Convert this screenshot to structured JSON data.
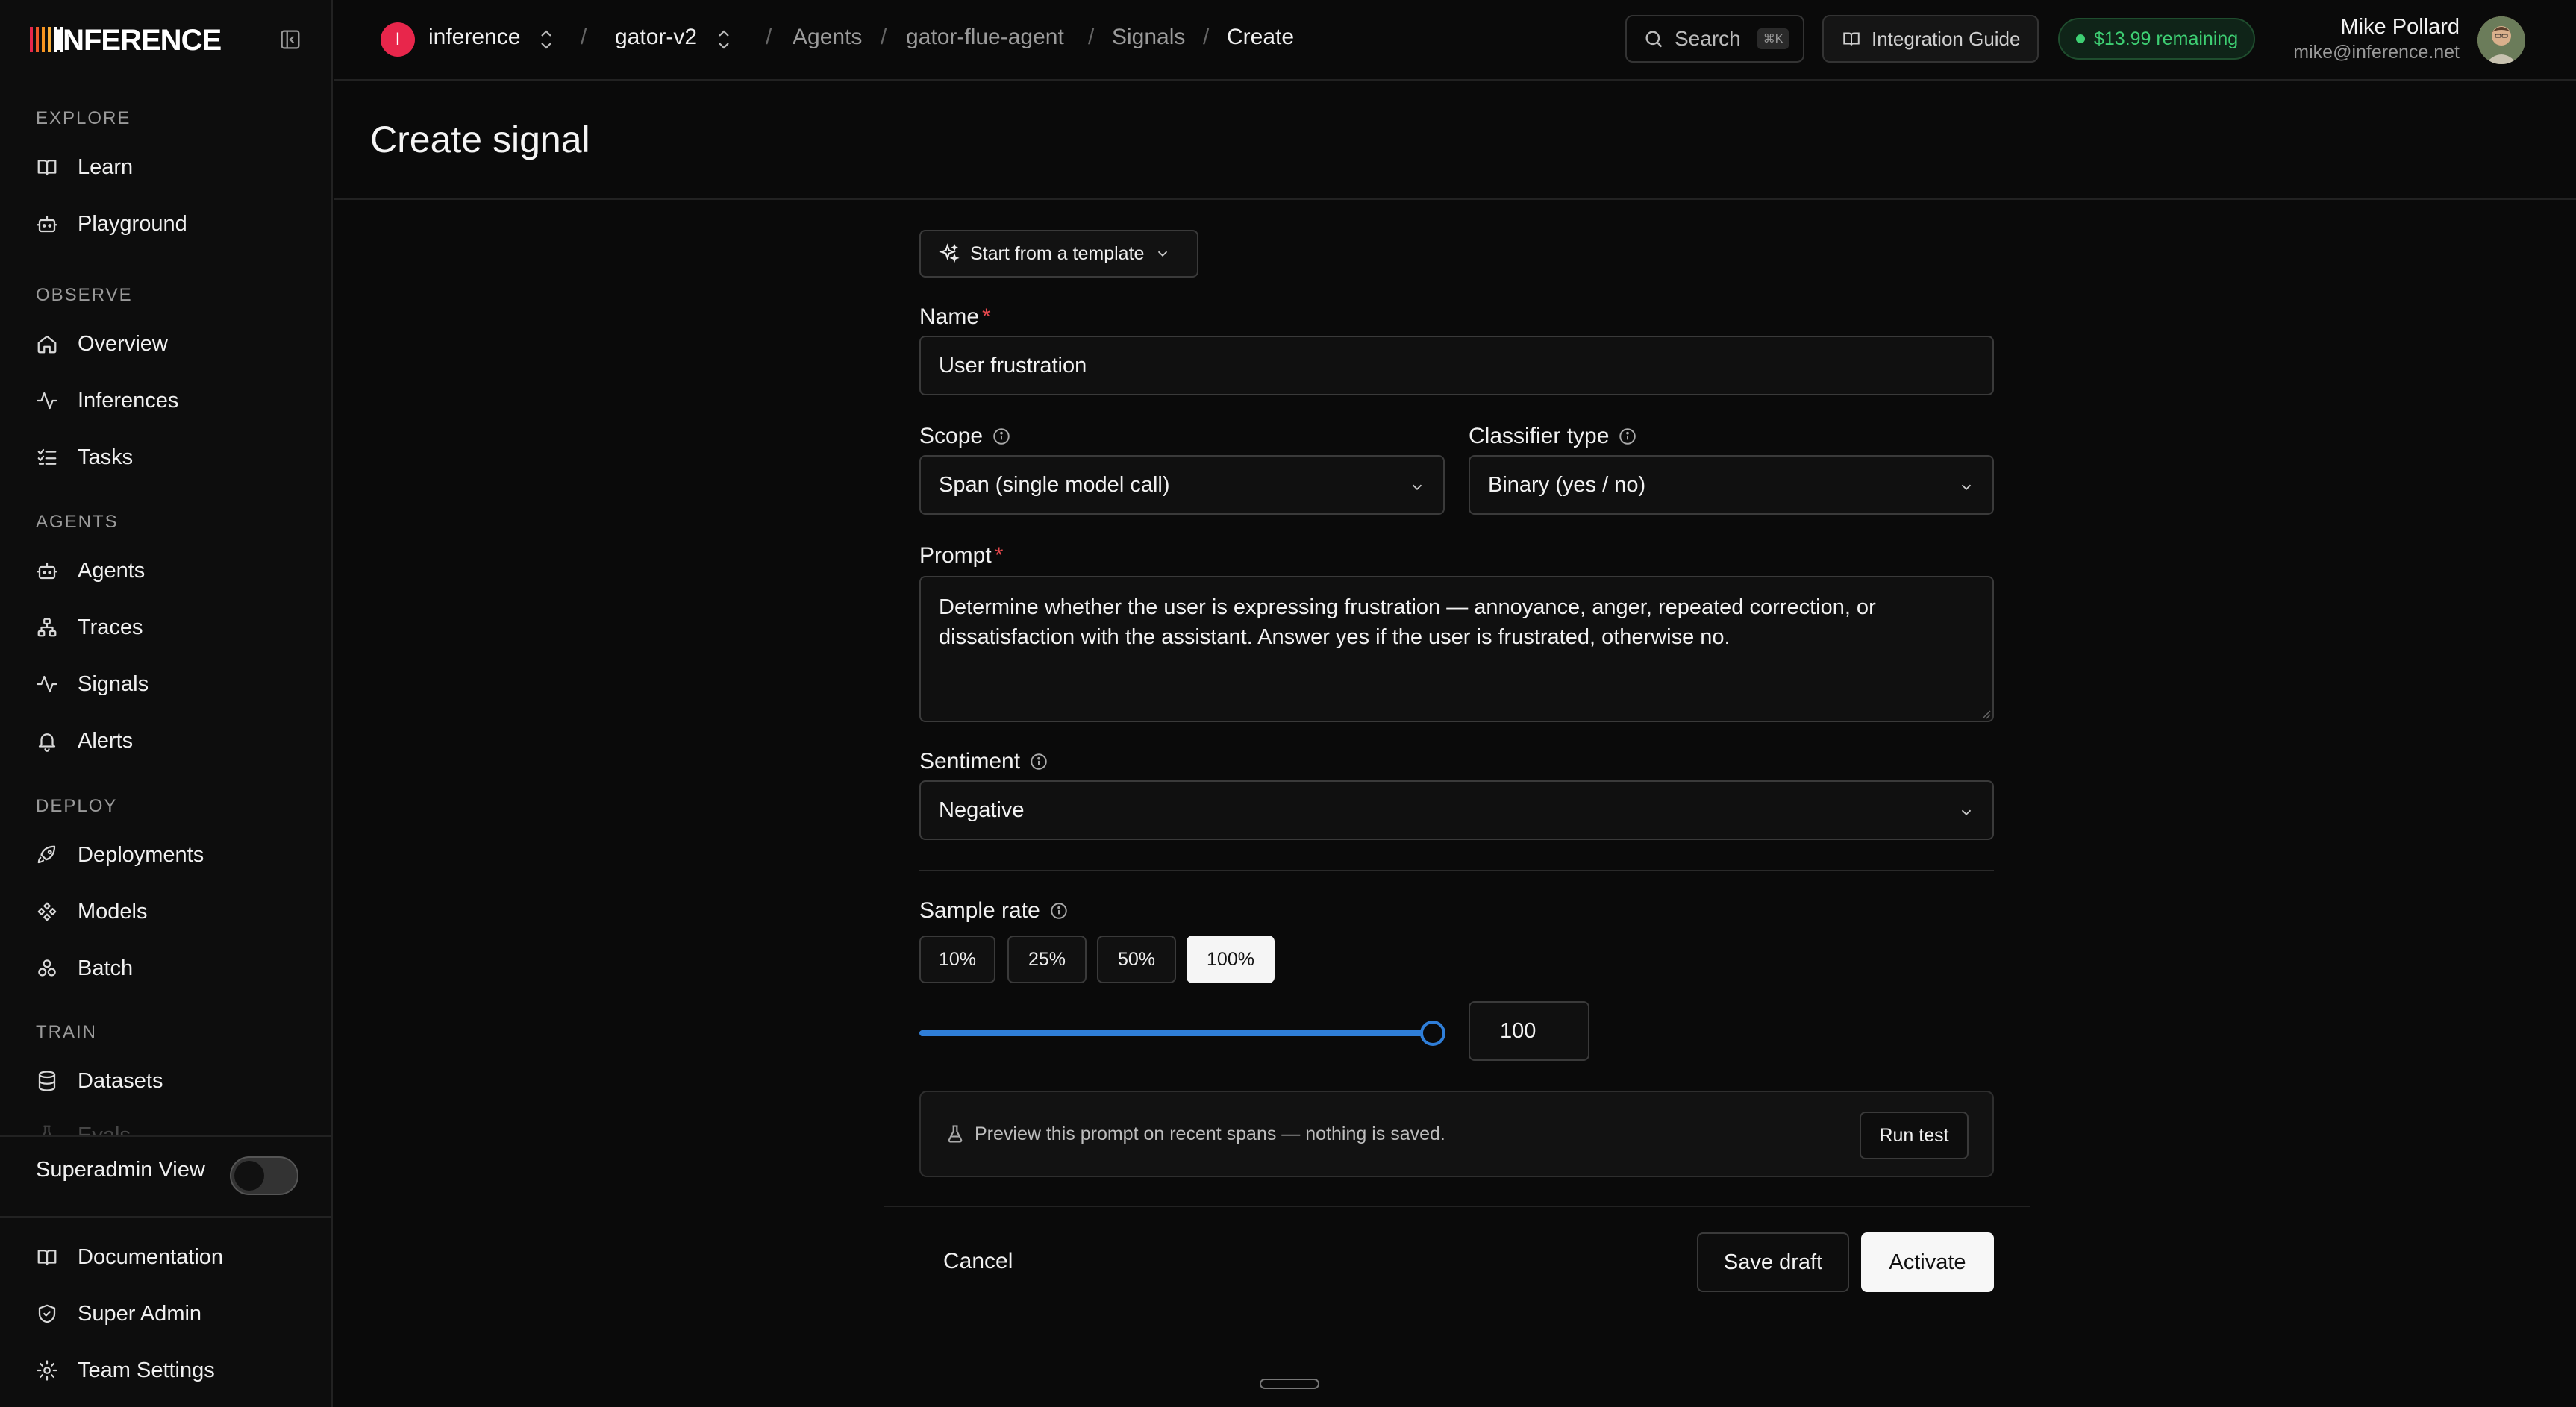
{
  "brand": {
    "name": "INFERENCE",
    "bar_colors": [
      "#e8264b",
      "#f05a28",
      "#f7931e",
      "#fbb03b",
      "#ffffff",
      "#ffffff"
    ]
  },
  "sidebar": {
    "sections": [
      {
        "title": "EXPLORE",
        "items": [
          {
            "label": "Learn",
            "icon": "book-icon"
          },
          {
            "label": "Playground",
            "icon": "robot-icon"
          }
        ]
      },
      {
        "title": "OBSERVE",
        "items": [
          {
            "label": "Overview",
            "icon": "home-icon"
          },
          {
            "label": "Inferences",
            "icon": "activity-icon"
          },
          {
            "label": "Tasks",
            "icon": "list-check-icon"
          }
        ]
      },
      {
        "title": "AGENTS",
        "items": [
          {
            "label": "Agents",
            "icon": "robot-icon"
          },
          {
            "label": "Traces",
            "icon": "network-icon"
          },
          {
            "label": "Signals",
            "icon": "activity-icon"
          },
          {
            "label": "Alerts",
            "icon": "bell-icon"
          }
        ]
      },
      {
        "title": "DEPLOY",
        "items": [
          {
            "label": "Deployments",
            "icon": "rocket-icon"
          },
          {
            "label": "Models",
            "icon": "models-icon"
          },
          {
            "label": "Batch",
            "icon": "batch-icon"
          }
        ]
      },
      {
        "title": "TRAIN",
        "items": [
          {
            "label": "Datasets",
            "icon": "database-icon"
          },
          {
            "label": "Evals",
            "icon": "flask-icon"
          }
        ]
      }
    ],
    "superadmin_label": "Superadmin View",
    "superadmin_on": false,
    "bottom_items": [
      {
        "label": "Documentation",
        "icon": "book-icon"
      },
      {
        "label": "Super Admin",
        "icon": "shield-icon"
      },
      {
        "label": "Team Settings",
        "icon": "gear-icon"
      }
    ]
  },
  "topbar": {
    "org_initial": "I",
    "org_name": "inference",
    "project_name": "gator-v2",
    "breadcrumbs": [
      "Agents",
      "gator-flue-agent",
      "Signals",
      "Create"
    ],
    "search_label": "Search",
    "search_shortcut": "⌘K",
    "guide_label": "Integration Guide",
    "credit_label": "$13.99 remaining",
    "user_name": "Mike Pollard",
    "user_email": "mike@inference.net"
  },
  "page": {
    "title": "Create signal"
  },
  "form": {
    "template_label": "Start from a template",
    "name_label": "Name",
    "name_value": "User frustration",
    "scope_label": "Scope",
    "scope_value": "Span (single model call)",
    "classifier_label": "Classifier type",
    "classifier_value": "Binary (yes / no)",
    "prompt_label": "Prompt",
    "prompt_value": "Determine whether the user is expressing frustration — annoyance, anger, repeated correction, or dissatisfaction with the assistant. Answer yes if the user is frustrated, otherwise no.",
    "sentiment_label": "Sentiment",
    "sentiment_value": "Negative",
    "sample_rate_label": "Sample rate",
    "rate_options": [
      "10%",
      "25%",
      "50%",
      "100%"
    ],
    "rate_selected": "100%",
    "rate_value": "100",
    "rate_fraction": 1.0,
    "preview_text": "Preview this prompt on recent spans — nothing is saved.",
    "run_test_label": "Run test",
    "cancel_label": "Cancel",
    "save_draft_label": "Save draft",
    "activate_label": "Activate"
  }
}
